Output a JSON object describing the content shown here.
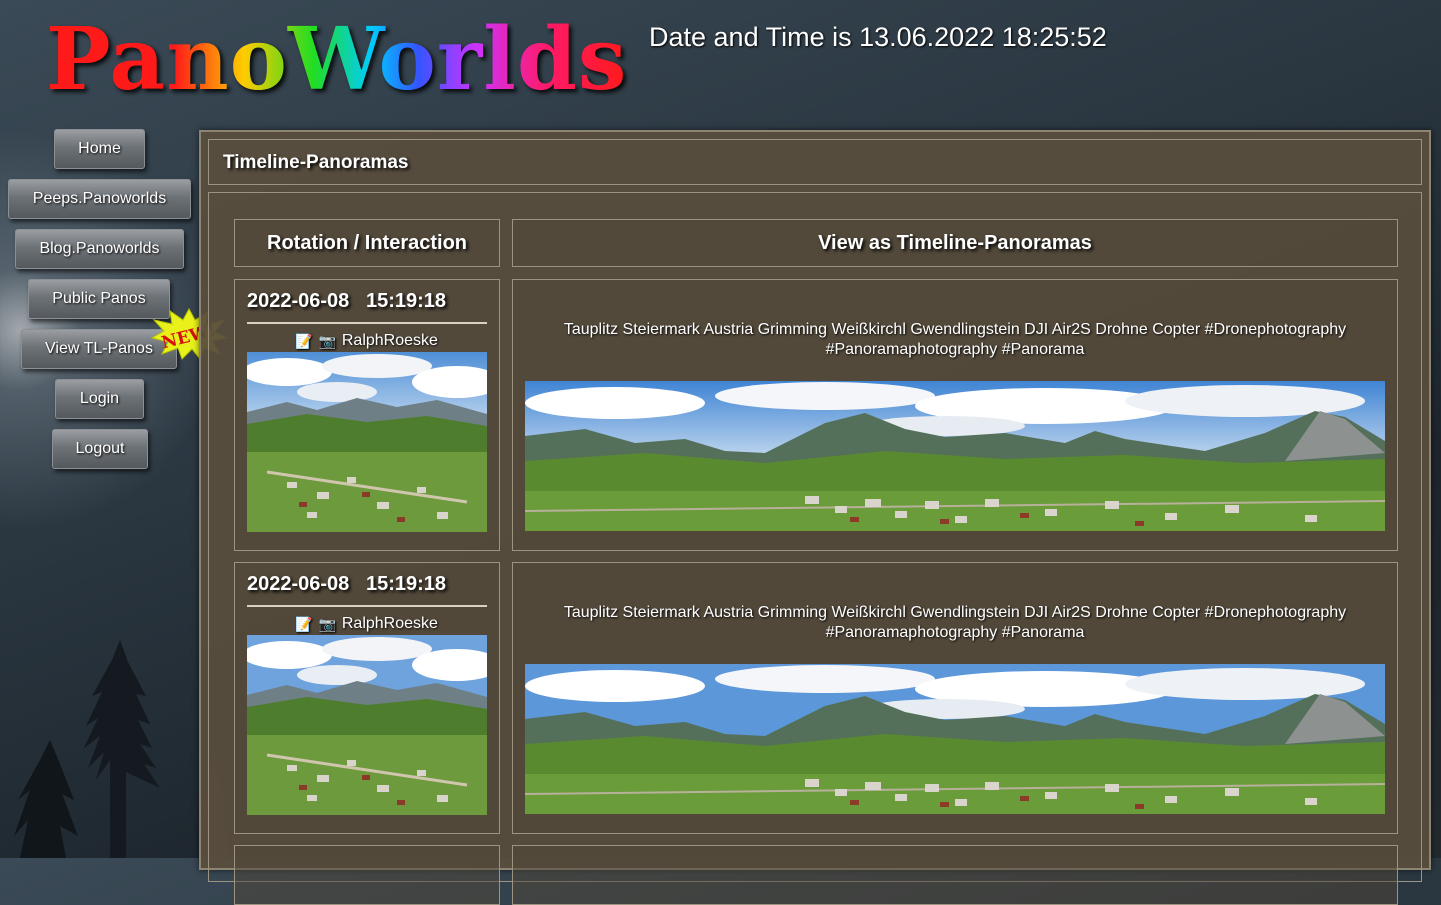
{
  "header": {
    "logo_text": "PanoWorlds",
    "datetime": "Date and Time is 13.06.2022 18:25:52"
  },
  "nav": {
    "items": [
      {
        "label": "Home"
      },
      {
        "label": "Peeps.Panoworlds"
      },
      {
        "label": "Blog.Panoworlds"
      },
      {
        "label": "Public Panos"
      },
      {
        "label": "View TL-Panos"
      },
      {
        "label": "Login"
      },
      {
        "label": "Logout"
      }
    ],
    "new_badge": "NEW!"
  },
  "panel": {
    "title": "Timeline-Panoramas",
    "col_left": "Rotation / Interaction",
    "col_right": "View as Timeline-Panoramas"
  },
  "entries": [
    {
      "date": "2022-06-08",
      "time": "15:19:18",
      "user": "RalphRoeske",
      "description": "Tauplitz Steiermark Austria Grimming Weißkirchl Gwendlingstein DJI Air2S Drohne Copter #Dronephotography #Panoramaphotography #Panorama"
    },
    {
      "date": "2022-06-08",
      "time": "15:19:18",
      "user": "RalphRoeske",
      "description": "Tauplitz Steiermark Austria Grimming Weißkirchl Gwendlingstein DJI Air2S Drohne Copter #Dronephotography #Panoramaphotography #Panorama"
    }
  ],
  "icons": {
    "edit": "edit-icon",
    "camera": "camera-icon"
  }
}
